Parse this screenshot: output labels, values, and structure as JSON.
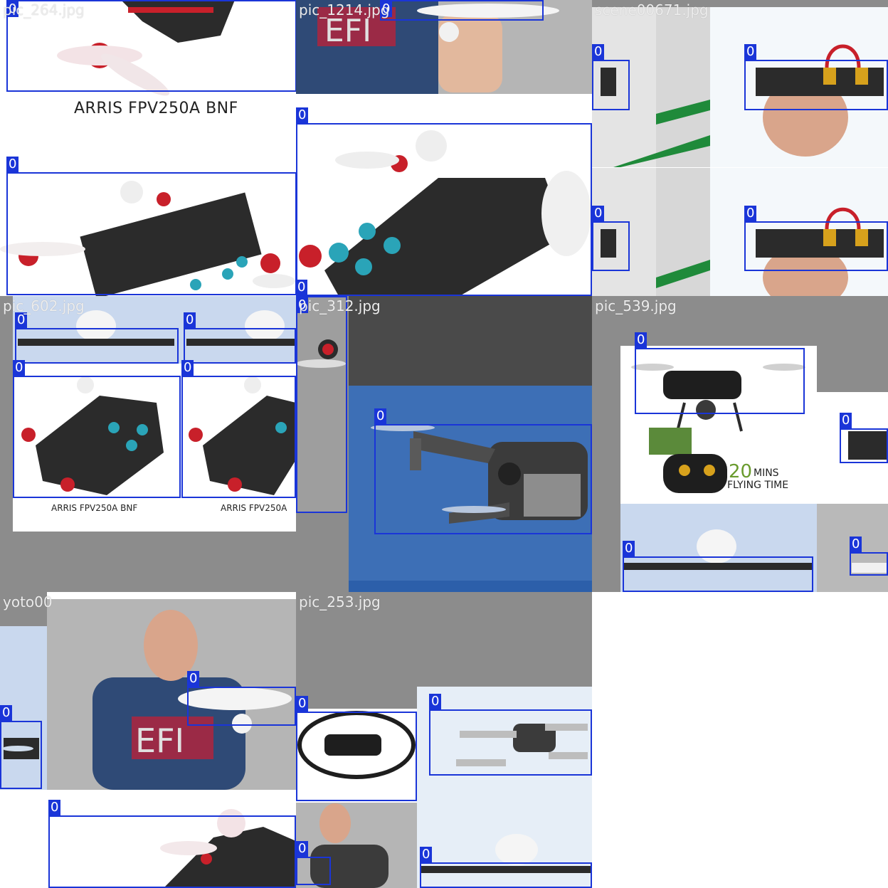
{
  "tiles": [
    {
      "name": "pic_264.jpg"
    },
    {
      "name": "pic_1214.jpg"
    },
    {
      "name": "scene00671.jpg"
    },
    {
      "name": "pic_602.jpg"
    },
    {
      "name": "pic_312.jpg"
    },
    {
      "name": "pic_539.jpg"
    },
    {
      "name": "yoto00"
    },
    {
      "name": "pic_253.jpg"
    }
  ],
  "class_label": "0",
  "captions": {
    "arris_large": "ARRIS FPV250A BNF",
    "arris_small": "ARRIS FPV250A BNF",
    "arris_small_cut": "ARRIS FPV250A",
    "flight_minutes": "20",
    "flight_mins": "MINS",
    "flight_time": "FLYING TIME"
  },
  "colors": {
    "box": "#1a35d8",
    "pad_gray": "#8c8c8c",
    "sky_blue": "#3d6fb6",
    "brick": "#b8b8b8",
    "shirt": "#2f4a76",
    "shirt_print": "#9b2a46",
    "carbon": "#2b2b2b",
    "motor_red": "#c8202a",
    "teal": "#2aa4b8"
  }
}
